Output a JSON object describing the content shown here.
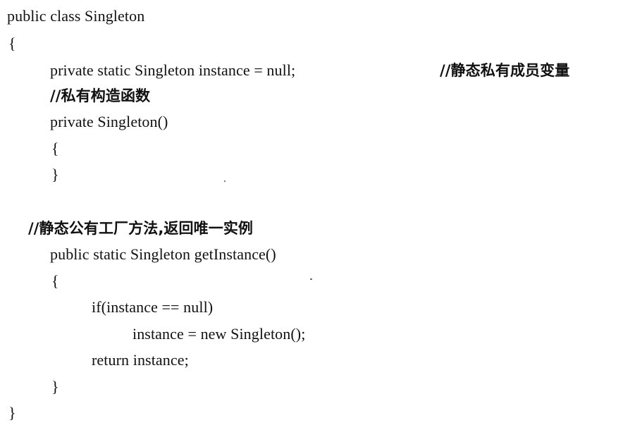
{
  "code_lines": [
    "public class Singleton",
    "{",
    "private static Singleton instance = null;",
    "//静态私有成员变量",
    "//私有构造函数",
    "private Singleton()",
    "{",
    "}",
    "//静态公有工厂方法,返回唯一实例",
    "public static Singleton getInstance()",
    "{",
    "if(instance == null)",
    "instance = new Singleton();",
    "return instance;",
    "}",
    "}"
  ]
}
